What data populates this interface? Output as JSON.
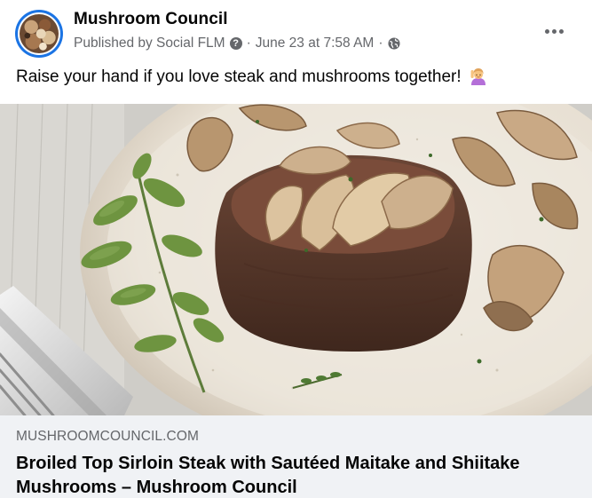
{
  "post": {
    "page_name": "Mushroom Council",
    "published_by": "Published by Social FLM",
    "separator": "·",
    "date": "June 23 at 7:58 AM",
    "help_glyph": "?",
    "audience_icon": "globe-icon",
    "more_icon": "more-options-icon",
    "message": "Raise your hand if you love steak and mushrooms together!",
    "emoji_icon": "woman-raising-hand-emoji"
  },
  "link_preview": {
    "domain": "MUSHROOMCOUNCIL.COM",
    "title": "Broiled Top Sirloin Steak with Sautéed Maitake and Shiitake Mushrooms – Mushroom Council"
  },
  "colors": {
    "name_text": "#050505",
    "meta_text": "#65676b",
    "avatar_ring": "#1b74e4",
    "link_box_bg": "#f0f2f5",
    "plate": "#ede6da",
    "steak": "#5a3a2c"
  }
}
